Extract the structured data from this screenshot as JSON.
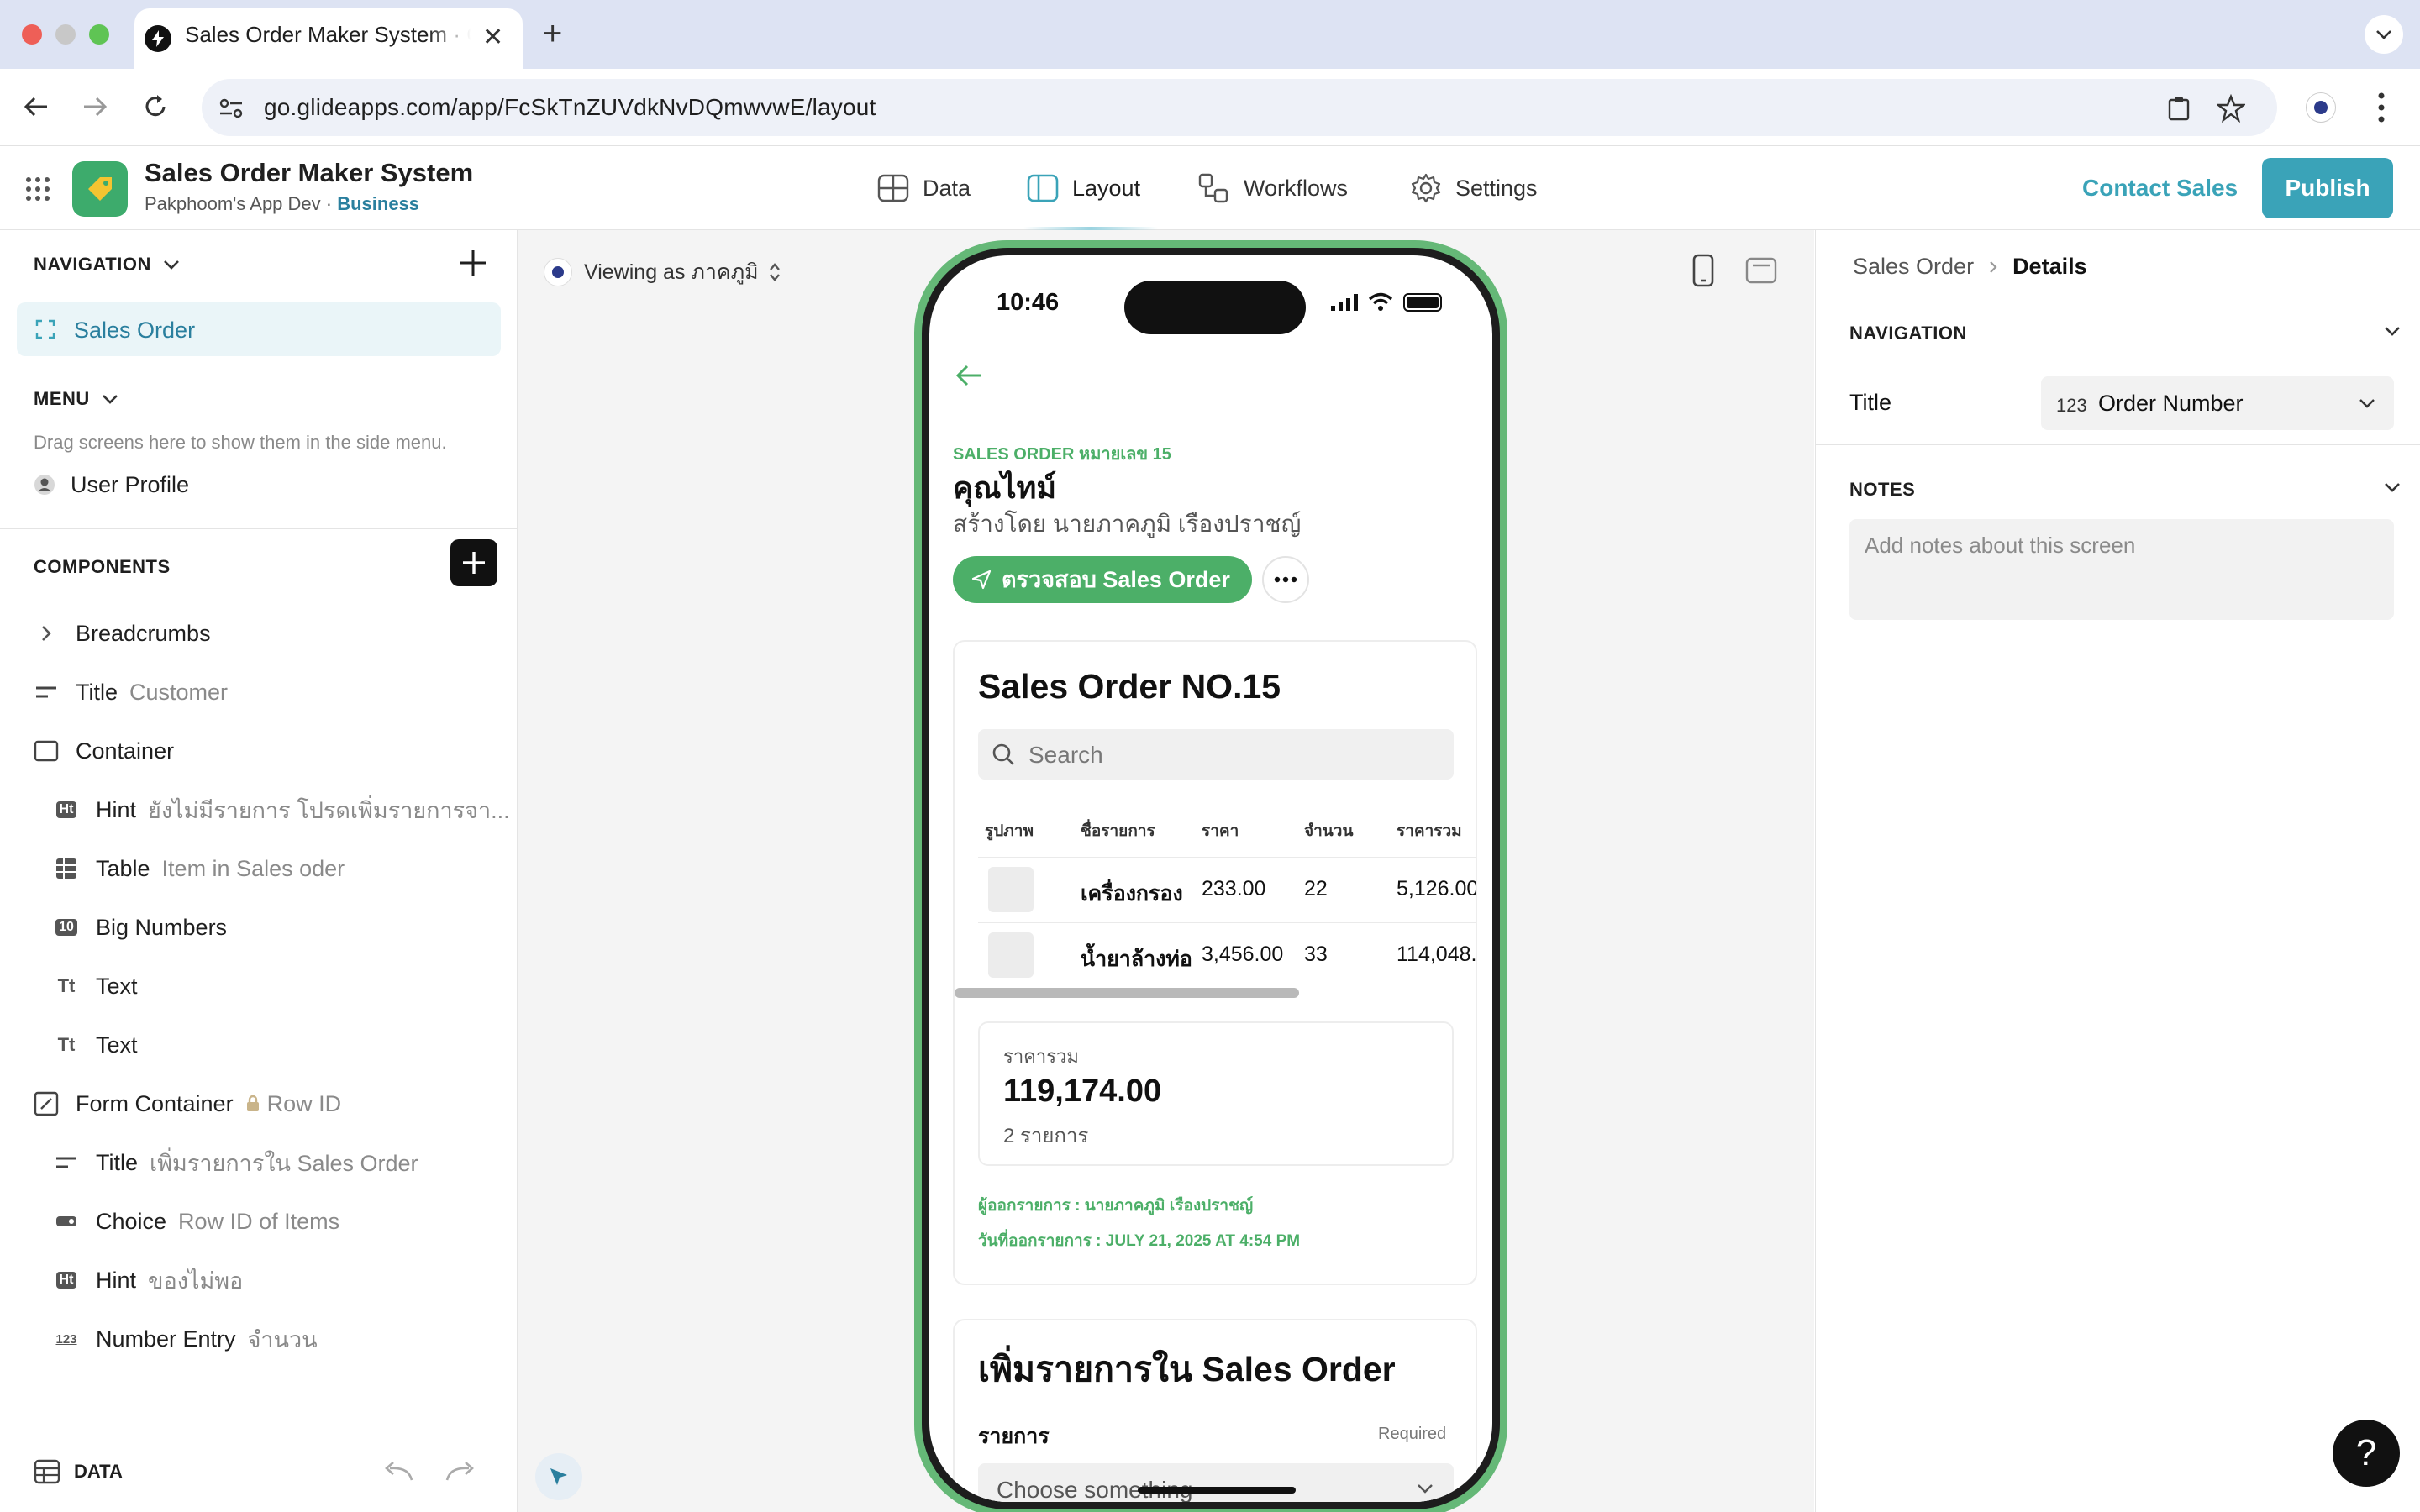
{
  "browser": {
    "tab_title": "Sales Order Maker System · Glide",
    "url": "go.glideapps.com/app/FcSkTnZUVdkNvDQmwvwE/layout"
  },
  "app": {
    "name": "Sales Order Maker System",
    "team": "Pakphoom's App Dev",
    "plan": "Business",
    "tabs": [
      "Data",
      "Layout",
      "Workflows",
      "Settings"
    ],
    "active_tab": "Layout",
    "contact_label": "Contact Sales",
    "publish_label": "Publish",
    "accent_color": "#3aa3b8"
  },
  "left": {
    "navigation_header": "NAVIGATION",
    "nav_item": "Sales Order",
    "menu_header": "MENU",
    "menu_hint": "Drag screens here to show them in the side menu.",
    "menu_item": "User Profile",
    "components_header": "COMPONENTS",
    "components": [
      {
        "type": "Breadcrumbs",
        "detail": ""
      },
      {
        "type": "Title",
        "detail": "Customer"
      },
      {
        "type": "Container",
        "detail": ""
      },
      {
        "type": "Hint",
        "detail": "ยังไม่มีรายการ โปรดเพิ่มรายการจา..."
      },
      {
        "type": "Table",
        "detail": "Item in Sales oder"
      },
      {
        "type": "Big Numbers",
        "detail": ""
      },
      {
        "type": "Text",
        "detail": ""
      },
      {
        "type": "Text",
        "detail": ""
      },
      {
        "type": "Form Container",
        "detail": "Row ID"
      },
      {
        "type": "Title",
        "detail": "เพิ่มรายการใน Sales Order"
      },
      {
        "type": "Choice",
        "detail": "Row ID of Items"
      },
      {
        "type": "Hint",
        "detail": "ของไม่พอ"
      },
      {
        "type": "Number Entry",
        "detail": "จำนวน"
      }
    ],
    "data_label": "DATA"
  },
  "canvas": {
    "viewing_as": "Viewing as ภาคภูมิ"
  },
  "phone": {
    "time": "10:46",
    "overline": "SALES ORDER หมายเลข 15",
    "customer": "คุณไทม์",
    "created_by": "สร้างโดย นายภาคภูมิ เรืองปราชญ์",
    "action_button": "ตรวจสอบ Sales Order",
    "card_title": "Sales Order NO.15",
    "search_placeholder": "Search",
    "table": {
      "headers": [
        "รูปภาพ",
        "ชื่อรายการ",
        "ราคา",
        "จำนวน",
        "ราคารวม"
      ],
      "rows": [
        [
          "",
          "เครื่องกรอง",
          "233.00",
          "22",
          "5,126.00"
        ],
        [
          "",
          "น้ำยาล้างท่อ",
          "3,456.00",
          "33",
          "114,048."
        ]
      ]
    },
    "total_label": "ราคารวม",
    "total_value": "119,174.00",
    "total_items": "2 รายการ",
    "issuer": "ผู้ออกรายการ : นายภาคภูมิ เรืองปราชญ์",
    "issue_date": "วันที่ออกรายการ : JULY 21, 2025 AT 4:54 PM",
    "form_title": "เพิ่มรายการใน Sales Order",
    "form_field_label": "รายการ",
    "form_required": "Required",
    "form_choice_placeholder": "Choose something",
    "green": "#4caf68"
  },
  "right": {
    "breadcrumb_parent": "Sales Order",
    "breadcrumb_current": "Details",
    "navigation_header": "NAVIGATION",
    "title_label": "Title",
    "title_value_prefix": "123",
    "title_value": "Order Number",
    "notes_header": "NOTES",
    "notes_placeholder": "Add notes about this screen"
  },
  "help_label": "?"
}
